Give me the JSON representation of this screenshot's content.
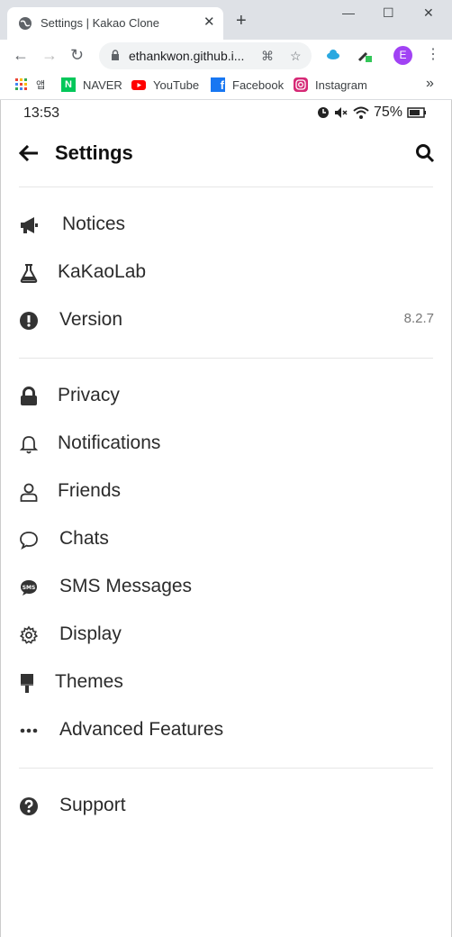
{
  "browser": {
    "tab_title": "Settings | Kakao Clone",
    "url": "ethankwon.github.i...",
    "profile_initial": "E",
    "bookmarks": [
      "앱",
      "NAVER",
      "YouTube",
      "Facebook",
      "Instagram"
    ],
    "more_bookmarks": "»"
  },
  "status": {
    "time": "13:53",
    "battery": "75%"
  },
  "header": {
    "title": "Settings"
  },
  "sections": [
    [
      {
        "label": "Notices",
        "icon": "megaphone-icon"
      },
      {
        "label": "KaKaoLab",
        "icon": "flask-icon"
      },
      {
        "label": "Version",
        "icon": "exclamation-circle-icon",
        "value": "8.2.7"
      }
    ],
    [
      {
        "label": "Privacy",
        "icon": "lock-icon"
      },
      {
        "label": "Notifications",
        "icon": "bell-icon"
      },
      {
        "label": "Friends",
        "icon": "user-icon"
      },
      {
        "label": "Chats",
        "icon": "chat-bubble-icon"
      },
      {
        "label": "SMS Messages",
        "icon": "sms-icon"
      },
      {
        "label": "Display",
        "icon": "gear-icon"
      },
      {
        "label": "Themes",
        "icon": "paint-brush-icon"
      },
      {
        "label": "Advanced Features",
        "icon": "ellipsis-icon"
      }
    ],
    [
      {
        "label": "Support",
        "icon": "question-circle-icon"
      }
    ]
  ]
}
